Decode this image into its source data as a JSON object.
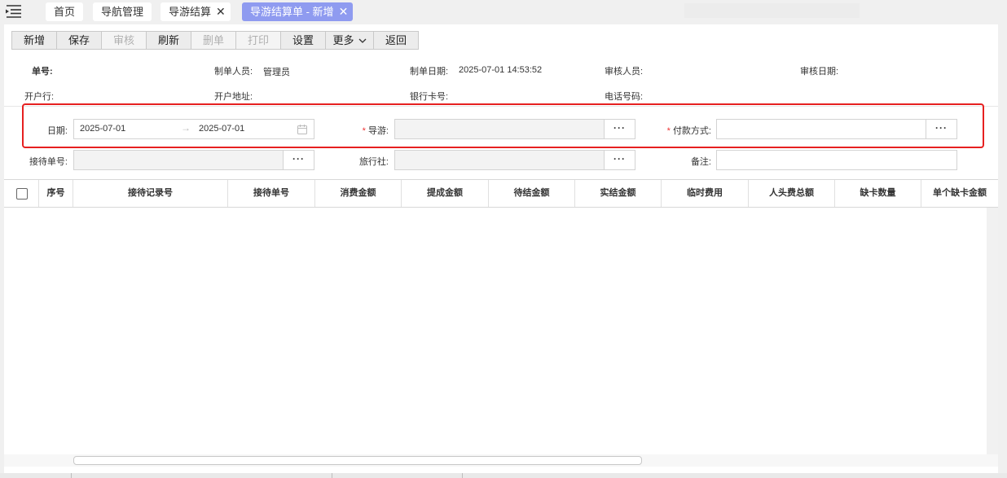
{
  "tabs": [
    {
      "label": "首页"
    },
    {
      "label": "导航管理"
    },
    {
      "label": "导游结算",
      "close": "✕"
    },
    {
      "label": "导游结算单 - 新增",
      "close": "✕"
    }
  ],
  "toolbar": {
    "buttons": [
      {
        "label": "新增"
      },
      {
        "label": "保存"
      },
      {
        "label": "审核"
      },
      {
        "label": "刷新"
      },
      {
        "label": "删单"
      },
      {
        "label": "打印"
      },
      {
        "label": "设置"
      },
      {
        "label": "更多"
      },
      {
        "label": "返回"
      }
    ]
  },
  "info": {
    "doc_no_label": "单号:",
    "maker_label": "制单人员:",
    "maker_value": "管理员",
    "make_date_label": "制单日期:",
    "make_date_value": "2025-07-01 14:53:52",
    "auditor_label": "审核人员:",
    "audit_date_label": "审核日期:",
    "bank_label": "开户行:",
    "bank_address_label": "开户地址:",
    "card_label": "银行卡号:",
    "phone_label": "电话号码:"
  },
  "form": {
    "date_label": "日期:",
    "date_from": "2025-07-01",
    "date_arrow": "→",
    "date_to": "2025-07-01",
    "guide_required": "*",
    "guide_label": "导游:",
    "guide_btn": "···",
    "payment_required": "*",
    "payment_label": "付款方式:",
    "payment_btn": "···",
    "reception_label": "接待单号:",
    "reception_btn": "···",
    "agency_label": "旅行社:",
    "agency_btn": "···",
    "remark_label": "备注:"
  },
  "grid": {
    "columns": [
      "序号",
      "接待记录号",
      "接待单号",
      "消费金额",
      "提成金额",
      "待结金额",
      "实结金额",
      "临时费用",
      "人头费总额",
      "缺卡数量",
      "单个缺卡金额"
    ]
  }
}
